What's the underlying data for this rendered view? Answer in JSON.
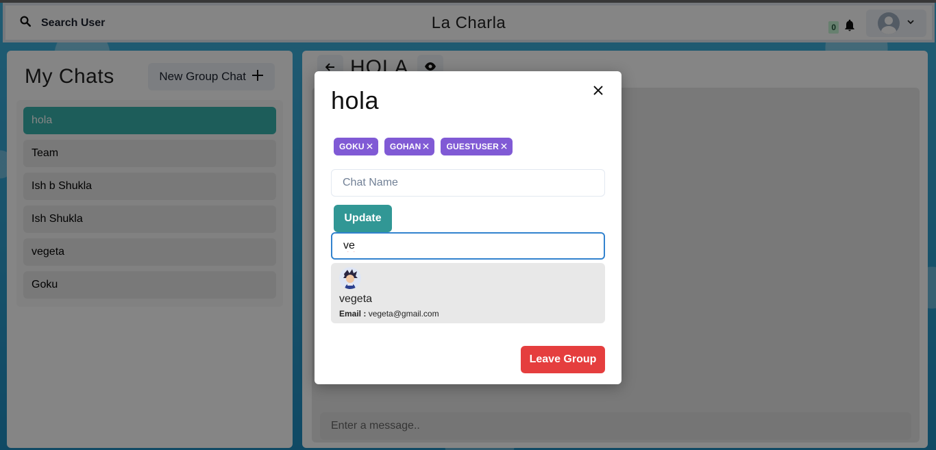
{
  "header": {
    "search_label": "Search User",
    "app_title": "La Charla",
    "notification_count": "0"
  },
  "sidebar": {
    "title": "My Chats",
    "new_group_label": "New Group Chat",
    "chats": [
      {
        "label": "hola",
        "active": true
      },
      {
        "label": "Team",
        "active": false
      },
      {
        "label": "Ish b Shukla",
        "active": false
      },
      {
        "label": "Ish Shukla",
        "active": false
      },
      {
        "label": "vegeta",
        "active": false
      },
      {
        "label": "Goku",
        "active": false
      }
    ]
  },
  "chat": {
    "title": "HOLA",
    "message_placeholder": "Enter a message.."
  },
  "modal": {
    "title": "hola",
    "members": [
      "GOKU",
      "GOHAN",
      "GUESTUSER"
    ],
    "chat_name_placeholder": "Chat Name",
    "update_label": "Update",
    "search_value": "ve",
    "result": {
      "name": "vegeta",
      "email_label": "Email :",
      "email": "vegeta@gmail.com"
    },
    "leave_label": "Leave Group"
  },
  "colors": {
    "accent_teal": "#319795",
    "tag_purple": "#805ad5",
    "danger_red": "#e53e3e",
    "focus_blue": "#3182ce"
  }
}
